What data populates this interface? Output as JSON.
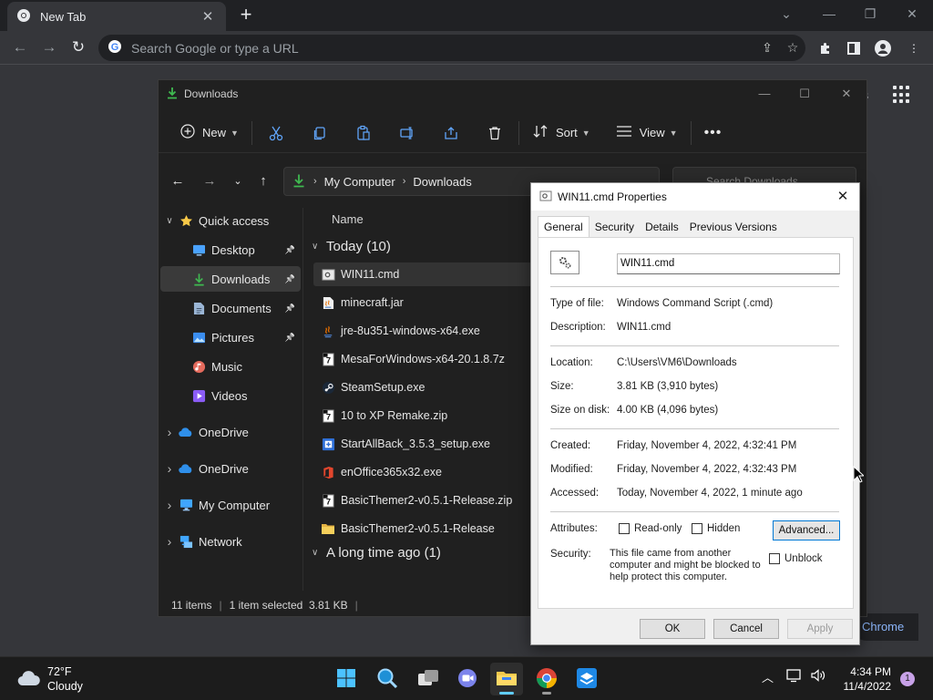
{
  "browser": {
    "tab_title": "New Tab",
    "tab_close": "✕",
    "new_tab": "+",
    "omnibox_placeholder": "Search Google or type a URL",
    "side_chip": "Chrome",
    "peek_text": "s"
  },
  "explorer": {
    "title": "Downloads",
    "toolbar": {
      "new_label": "New",
      "sort_label": "Sort",
      "view_label": "View"
    },
    "breadcrumb": [
      "My Computer",
      "Downloads"
    ],
    "search_placeholder": "Search Downloads",
    "nav": [
      {
        "label": "Quick access",
        "icon": "star-icon",
        "pinned": false,
        "expand": true
      },
      {
        "label": "Desktop",
        "icon": "desktop-icon",
        "pinned": true
      },
      {
        "label": "Downloads",
        "icon": "download-icon",
        "pinned": true,
        "selected": true
      },
      {
        "label": "Documents",
        "icon": "document-icon",
        "pinned": true
      },
      {
        "label": "Pictures",
        "icon": "pictures-icon",
        "pinned": true
      },
      {
        "label": "Music",
        "icon": "music-icon",
        "pinned": false
      },
      {
        "label": "Videos",
        "icon": "videos-icon",
        "pinned": false
      },
      {
        "label": "OneDrive",
        "icon": "onedrive-icon",
        "expand": true
      },
      {
        "label": "OneDrive",
        "icon": "onedrive-icon",
        "expand": true
      },
      {
        "label": "My Computer",
        "icon": "computer-icon",
        "expand": true
      },
      {
        "label": "Network",
        "icon": "network-icon",
        "expand": true
      }
    ],
    "column_name": "Name",
    "groups": [
      {
        "label": "Today (10)"
      },
      {
        "label": "A long time ago (1)"
      }
    ],
    "files": [
      {
        "name": "WIN11.cmd",
        "icon": "cmd-file-icon",
        "selected": true
      },
      {
        "name": "minecraft.jar",
        "icon": "jar-file-icon"
      },
      {
        "name": "jre-8u351-windows-x64.exe",
        "icon": "java-installer-icon"
      },
      {
        "name": "MesaForWindows-x64-20.1.8.7z",
        "icon": "archive-icon"
      },
      {
        "name": "SteamSetup.exe",
        "icon": "steam-icon"
      },
      {
        "name": "10 to XP Remake.zip",
        "icon": "archive-icon"
      },
      {
        "name": "StartAllBack_3.5.3_setup.exe",
        "icon": "installer-icon"
      },
      {
        "name": "enOffice365x32.exe",
        "icon": "office-icon"
      },
      {
        "name": "BasicThemer2-v0.5.1-Release.zip",
        "icon": "archive-icon"
      },
      {
        "name": "BasicThemer2-v0.5.1-Release",
        "icon": "folder-icon"
      }
    ],
    "status": {
      "items": "11 items",
      "selected": "1 item selected  3.81 KB"
    }
  },
  "properties": {
    "title": "WIN11.cmd Properties",
    "tabs": [
      "General",
      "Security",
      "Details",
      "Previous Versions"
    ],
    "file_name": "WIN11.cmd",
    "rows": {
      "type_label": "Type of file:",
      "type_value": "Windows Command Script (.cmd)",
      "desc_label": "Description:",
      "desc_value": "WIN11.cmd",
      "loc_label": "Location:",
      "loc_value": "C:\\Users\\VM6\\Downloads",
      "size_label": "Size:",
      "size_value": "3.81 KB (3,910 bytes)",
      "disk_label": "Size on disk:",
      "disk_value": "4.00 KB (4,096 bytes)",
      "created_label": "Created:",
      "created_value": "Friday, November 4, 2022, 4:32:41 PM",
      "modified_label": "Modified:",
      "modified_value": "Friday, November 4, 2022, 4:32:43 PM",
      "accessed_label": "Accessed:",
      "accessed_value": "Today, November 4, 2022, 1 minute ago",
      "attr_label": "Attributes:",
      "security_label": "Security:"
    },
    "readonly_label": "Read-only",
    "hidden_label": "Hidden",
    "advanced_label": "Advanced...",
    "security_text": "This file came from another computer and might be blocked to help protect this computer.",
    "unblock_label": "Unblock",
    "ok_label": "OK",
    "cancel_label": "Cancel",
    "apply_label": "Apply"
  },
  "taskbar": {
    "weather_temp": "72°F",
    "weather_desc": "Cloudy",
    "time": "4:34 PM",
    "date": "11/4/2022",
    "notification_count": "1"
  },
  "colors": {
    "accent": "#0078d4",
    "explorer_bg": "#202020",
    "chrome_bg": "#35363a",
    "folder": "#f2c94c"
  }
}
